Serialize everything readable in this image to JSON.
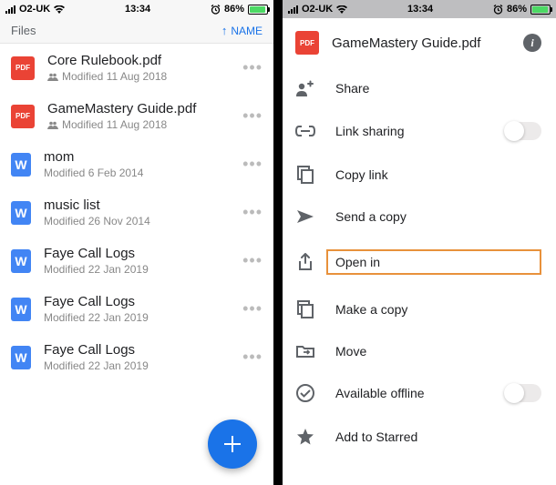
{
  "status": {
    "carrier": "O2-UK",
    "time": "13:34",
    "battery_pct": "86%"
  },
  "left": {
    "header_label": "Files",
    "sort_label": "NAME",
    "files": [
      {
        "name": "Core Rulebook.pdf",
        "sub": "Modified 11 Aug 2018",
        "type": "pdf",
        "shared": true
      },
      {
        "name": "GameMastery Guide.pdf",
        "sub": "Modified 11 Aug 2018",
        "type": "pdf",
        "shared": true
      },
      {
        "name": "mom",
        "sub": "Modified 6 Feb 2014",
        "type": "doc",
        "shared": false
      },
      {
        "name": "music list",
        "sub": "Modified 26 Nov 2014",
        "type": "doc",
        "shared": false
      },
      {
        "name": "Faye Call Logs",
        "sub": "Modified 22 Jan 2019",
        "type": "doc",
        "shared": false
      },
      {
        "name": "Faye Call Logs",
        "sub": "Modified 22 Jan 2019",
        "type": "doc",
        "shared": false
      },
      {
        "name": "Faye Call Logs",
        "sub": "Modified 22 Jan 2019",
        "type": "doc",
        "shared": false
      }
    ]
  },
  "right": {
    "title": "GameMastery Guide.pdf",
    "menu": [
      {
        "icon": "share",
        "label": "Share",
        "toggle": false
      },
      {
        "icon": "link",
        "label": "Link sharing",
        "toggle": true
      },
      {
        "icon": "copy",
        "label": "Copy link",
        "toggle": false
      },
      {
        "icon": "send",
        "label": "Send a copy",
        "toggle": false
      },
      {
        "icon": "openin",
        "label": "Open in",
        "toggle": false,
        "highlight": true
      },
      {
        "icon": "makecopy",
        "label": "Make a copy",
        "toggle": false
      },
      {
        "icon": "move",
        "label": "Move",
        "toggle": false
      },
      {
        "icon": "offline",
        "label": "Available offline",
        "toggle": true
      },
      {
        "icon": "star",
        "label": "Add to Starred",
        "toggle": false
      }
    ]
  }
}
